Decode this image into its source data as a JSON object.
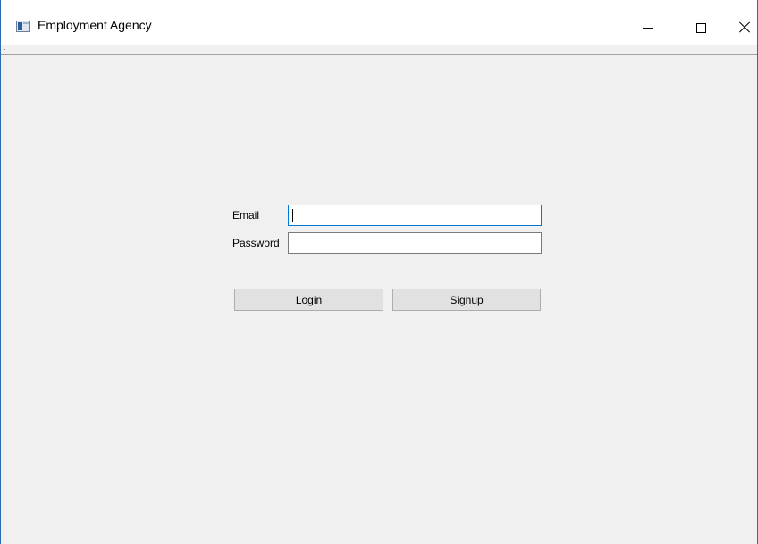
{
  "window": {
    "title": "Employment Agency",
    "icon": "app-window-icon",
    "controls": [
      "minimize-icon",
      "maximize-icon",
      "close-icon"
    ]
  },
  "form": {
    "email_label": "Email",
    "email_value": "",
    "password_label": "Password",
    "password_value": ""
  },
  "buttons": {
    "login_label": "Login",
    "signup_label": "Signup"
  },
  "colors": {
    "focus_border": "#0078d7",
    "window_bg": "#f0f0f0",
    "button_bg": "#e1e1e1"
  }
}
